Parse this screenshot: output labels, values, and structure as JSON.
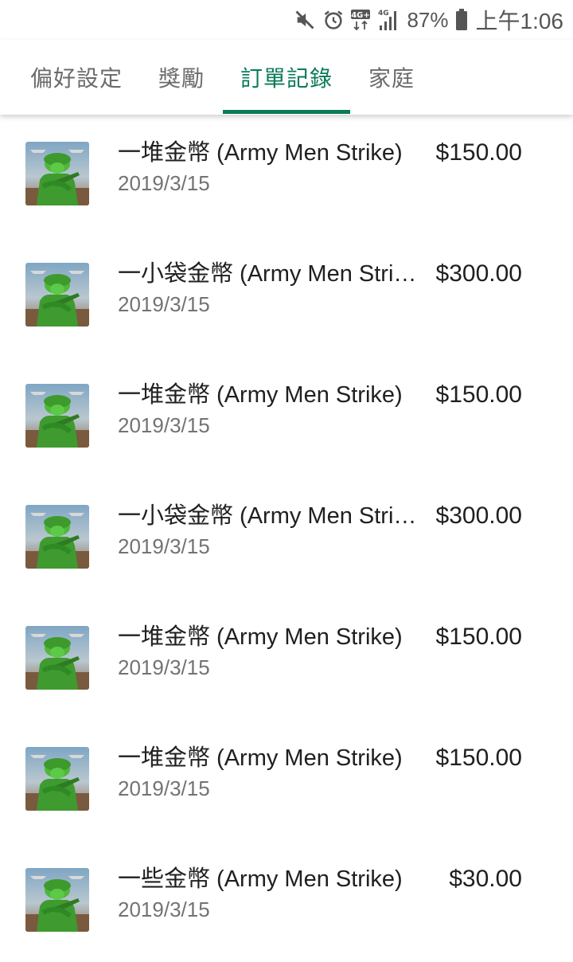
{
  "status_bar": {
    "icons": [
      "mute-icon",
      "alarm-icon",
      "4g-plus-icon",
      "signal-icon",
      "battery-icon"
    ],
    "network_label": "4G+",
    "network_sub_label": "4G",
    "battery_percent": "87%",
    "time": "上午1:06"
  },
  "tabs": [
    {
      "label": "偏好設定",
      "active": false
    },
    {
      "label": "獎勵",
      "active": false
    },
    {
      "label": "訂單記錄",
      "active": true
    },
    {
      "label": "家庭",
      "active": false
    }
  ],
  "colors": {
    "accent": "#0a7a5a",
    "text_primary": "#202020",
    "text_secondary": "#737373",
    "tab_inactive": "#6b6b6b"
  },
  "orders": [
    {
      "title": "一堆金幣 (Army Men Strike)",
      "price": "$150.00",
      "date": "2019/3/15",
      "icon": "army-men-strike-app-icon"
    },
    {
      "title": "一小袋金幣 (Army Men Strike)",
      "price": "$300.00",
      "date": "2019/3/15",
      "icon": "army-men-strike-app-icon"
    },
    {
      "title": "一堆金幣 (Army Men Strike)",
      "price": "$150.00",
      "date": "2019/3/15",
      "icon": "army-men-strike-app-icon"
    },
    {
      "title": "一小袋金幣 (Army Men Strike)",
      "price": "$300.00",
      "date": "2019/3/15",
      "icon": "army-men-strike-app-icon"
    },
    {
      "title": "一堆金幣 (Army Men Strike)",
      "price": "$150.00",
      "date": "2019/3/15",
      "icon": "army-men-strike-app-icon"
    },
    {
      "title": "一堆金幣 (Army Men Strike)",
      "price": "$150.00",
      "date": "2019/3/15",
      "icon": "army-men-strike-app-icon"
    },
    {
      "title": "一些金幣 (Army Men Strike)",
      "price": "$30.00",
      "date": "2019/3/15",
      "icon": "army-men-strike-app-icon"
    }
  ]
}
